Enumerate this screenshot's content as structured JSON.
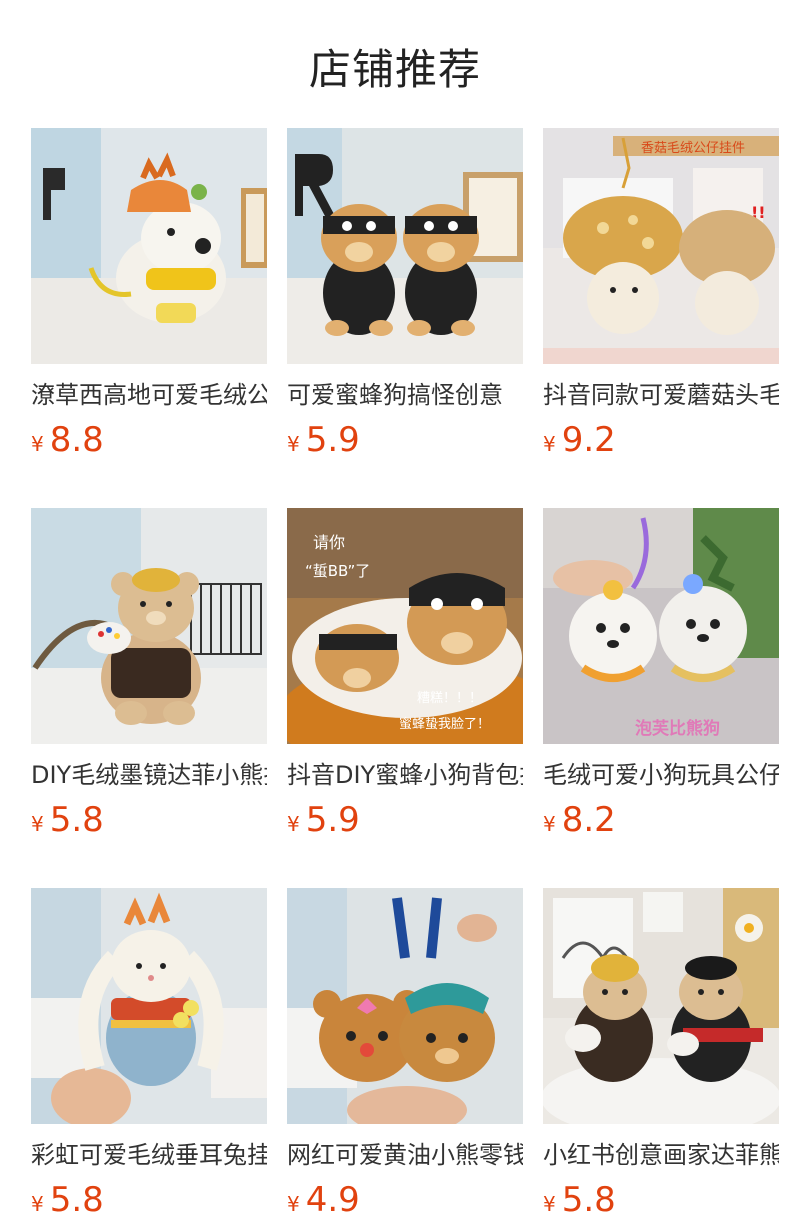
{
  "section": {
    "title": "店铺推荐"
  },
  "currency_symbol": "¥",
  "products": [
    {
      "name": "潦草西高地可爱毛绒公仔挂件",
      "price": "8.8",
      "image": "westie-plush-keychain"
    },
    {
      "name": "可爱蜜蜂狗搞怪创意",
      "price": "5.9",
      "image": "bee-dog-plush-pair"
    },
    {
      "name": "抖音同款可爱蘑菇头毛绒公仔挂件",
      "price": "9.2",
      "image": "mushroom-plush-keychain",
      "image_text": [
        "香菇毛绒公仔挂件",
        "!!"
      ]
    },
    {
      "name": "DIY毛绒墨镜达菲小熊挂件",
      "price": "5.8",
      "image": "duffy-painter-bear"
    },
    {
      "name": "抖音DIY蜜蜂小狗背包挂件",
      "price": "5.9",
      "image": "bee-dog-on-table",
      "image_text": [
        "请你",
        "“蜇BB”了",
        "糟糕！！！",
        "蜜蜂蛰我脸了！"
      ]
    },
    {
      "name": "毛绒可爱小狗玩具公仔挂件",
      "price": "8.2",
      "image": "white-puppy-plush",
      "image_text": [
        "泡芙比熊狗"
      ]
    },
    {
      "name": "彩虹可爱毛绒垂耳兔挂件",
      "price": "5.8",
      "image": "rainbow-lop-bunny"
    },
    {
      "name": "网红可爱黄油小熊零钱包挂件",
      "price": "4.9",
      "image": "butter-bear-coin-purse"
    },
    {
      "name": "小红书创意画家达菲熊挂件",
      "price": "5.8",
      "image": "painter-duffy-pair"
    }
  ]
}
